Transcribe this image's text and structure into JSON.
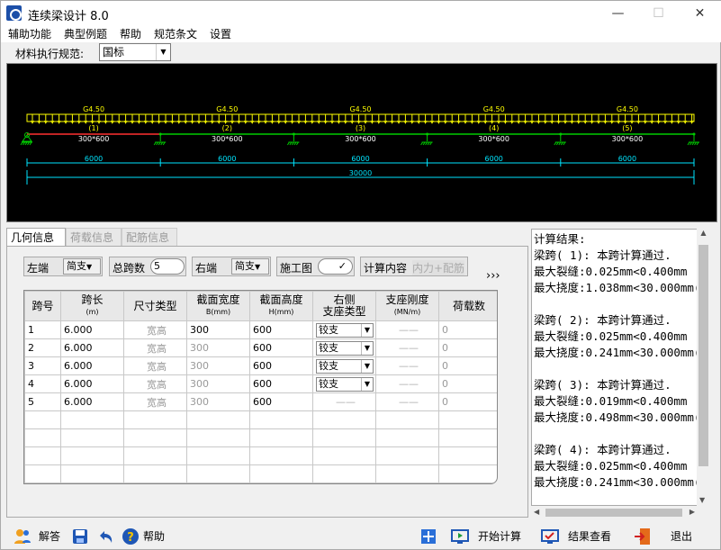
{
  "window": {
    "title": "连续梁设计 8.0",
    "min": "—",
    "max": "☐",
    "close": "✕"
  },
  "menu": [
    "辅助功能",
    "典型例题",
    "帮助",
    "规范条文",
    "设置"
  ],
  "norm": {
    "label": "材料执行规范:",
    "value": "国标"
  },
  "diagram": {
    "spans": [
      {
        "load": "G4.50",
        "index": "(1)",
        "section": "300*600",
        "length": "6000"
      },
      {
        "load": "G4.50",
        "index": "(2)",
        "section": "300*600",
        "length": "6000"
      },
      {
        "load": "G4.50",
        "index": "(3)",
        "section": "300*600",
        "length": "6000"
      },
      {
        "load": "G4.50",
        "index": "(4)",
        "section": "300*600",
        "length": "6000"
      },
      {
        "load": "G4.50",
        "index": "(5)",
        "section": "300*600",
        "length": "6000"
      }
    ],
    "total": "30000"
  },
  "tabs": [
    "几何信息",
    "荷载信息",
    "配筋信息"
  ],
  "controls": {
    "left_end_label": "左端",
    "left_end_value": "简支",
    "span_count_label": "总跨数",
    "span_count_value": "5",
    "right_end_label": "右端",
    "right_end_value": "简支",
    "drawing_label": "施工图",
    "drawing_value": "✓",
    "calc_label": "计算内容",
    "calc_value": "内力+配筋",
    "more": "›››"
  },
  "table": {
    "headers": [
      {
        "t": "跨号",
        "u": ""
      },
      {
        "t": "跨长",
        "u": "(m)"
      },
      {
        "t": "尺寸类型",
        "u": ""
      },
      {
        "t": "截面宽度",
        "u": "B(mm)"
      },
      {
        "t": "截面高度",
        "u": "H(mm)"
      },
      {
        "t": "右侧",
        "u": "支座类型"
      },
      {
        "t": "支座刚度",
        "u": "(MN/m)"
      },
      {
        "t": "荷载数",
        "u": ""
      }
    ],
    "rows": [
      {
        "no": "1",
        "len": "6.000",
        "type": "宽高",
        "b": "300",
        "h": "600",
        "support": "铰支",
        "stiff": "——",
        "loads": "0"
      },
      {
        "no": "2",
        "len": "6.000",
        "type": "宽高",
        "b": "300",
        "h": "600",
        "support": "铰支",
        "stiff": "——",
        "loads": "0"
      },
      {
        "no": "3",
        "len": "6.000",
        "type": "宽高",
        "b": "300",
        "h": "600",
        "support": "铰支",
        "stiff": "——",
        "loads": "0"
      },
      {
        "no": "4",
        "len": "6.000",
        "type": "宽高",
        "b": "300",
        "h": "600",
        "support": "铰支",
        "stiff": "——",
        "loads": "0"
      },
      {
        "no": "5",
        "len": "6.000",
        "type": "宽高",
        "b": "300",
        "h": "600",
        "support": "——",
        "stiff": "——",
        "loads": "0"
      }
    ]
  },
  "results": "计算结果:\n梁跨( 1): 本跨计算通过.\n最大裂缝:0.025mm<0.400mm\n最大挠度:1.038mm<30.000mm(\n\n梁跨( 2): 本跨计算通过.\n最大裂缝:0.025mm<0.400mm\n最大挠度:0.241mm<30.000mm(\n\n梁跨( 3): 本跨计算通过.\n最大裂缝:0.019mm<0.400mm\n最大挠度:0.498mm<30.000mm(\n\n梁跨( 4): 本跨计算通过.\n最大裂缝:0.025mm<0.400mm\n最大挠度:0.241mm<30.000mm(",
  "bottom": {
    "answer": "解答",
    "help": "帮助",
    "start": "开始计算",
    "view": "结果查看",
    "exit": "退出"
  },
  "colors": {
    "load": "#ffff00",
    "beam": "#00cc00",
    "dim": "#00e5ff",
    "highlight": "#ff3030"
  }
}
